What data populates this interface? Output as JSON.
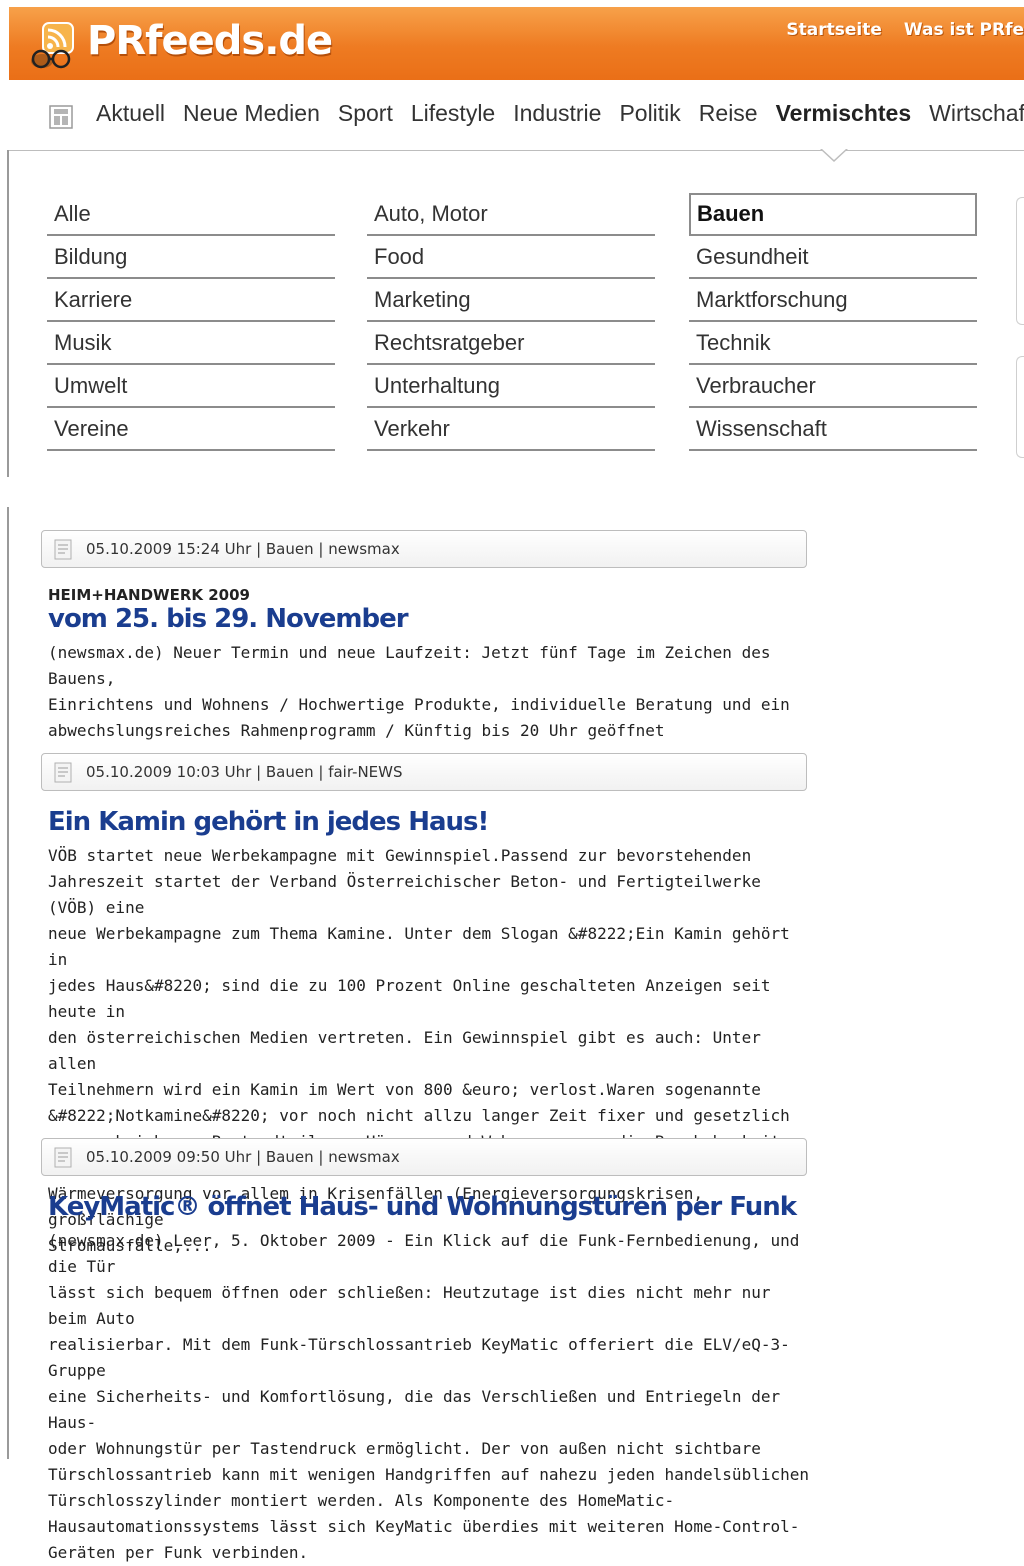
{
  "brand": {
    "logo_text": "PRfeeds.de",
    "accent": "#ef7d22",
    "link_color": "#1a3d8f"
  },
  "toplinks": [
    "Startseite",
    "Was ist PRfe"
  ],
  "nav": {
    "home_icon": "home-icon",
    "items": [
      "Aktuell",
      "Neue Medien",
      "Sport",
      "Lifestyle",
      "Industrie",
      "Politik",
      "Reise",
      "Vermischtes",
      "Wirtschaft"
    ],
    "active": "Vermischtes"
  },
  "categories": {
    "col1": [
      "Alle",
      "Bildung",
      "Karriere",
      "Musik",
      "Umwelt",
      "Vereine"
    ],
    "col2": [
      "Auto, Motor",
      "Food",
      "Marketing",
      "Rechtsratgeber",
      "Unterhaltung",
      "Verkehr"
    ],
    "col3": [
      "Bauen",
      "Gesundheit",
      "Marktforschung",
      "Technik",
      "Verbraucher",
      "Wissenschaft"
    ],
    "selected": "Bauen"
  },
  "articles": [
    {
      "meta": "05.10.2009 15:24 Uhr | Bauen | newsmax",
      "kicker": "HEIM+HANDWERK 2009",
      "title": "vom 25. bis 29. November",
      "lines": [
        "(newsmax.de) Neuer Termin und neue Laufzeit: Jetzt fünf Tage im Zeichen des Bauens,",
        "Einrichtens und Wohnens / Hochwertige Produkte, individuelle Beratung und ein",
        "abwechslungsreiches Rahmenprogramm / Künftig bis 20 Uhr geöffnet"
      ]
    },
    {
      "meta": "05.10.2009 10:03 Uhr | Bauen | fair-NEWS",
      "kicker": "",
      "title": "Ein Kamin gehört in jedes Haus!",
      "lines": [
        "VÖB startet neue Werbekampagne mit Gewinnspiel.Passend zur bevorstehenden",
        "Jahreszeit startet der Verband Österreichischer Beton- und Fertigteilwerke (VÖB) eine",
        "neue Werbekampagne zum Thema Kamine. Unter dem Slogan &#8222;Ein Kamin gehört in",
        "jedes Haus&#8220; sind die zu 100 Prozent Online geschalteten Anzeigen seit heute in",
        "den österreichischen Medien vertreten. Ein Gewinnspiel gibt es auch: Unter allen",
        "Teilnehmern wird ein Kamin im Wert von 800 &euro; verlost.Waren sogenannte",
        "&#8222;Notkamine&#8220; vor noch nicht allzu langer Zeit fixer und gesetzlich",
        "vorgeschriebener Bestandteil von Häusern und Wohnungen, um die Bewohnbarkeit und",
        "Wärmeversorgung vor allem in Krisenfällen (Energieversorgungskrisen, großflächige",
        "Stromausfälle,..."
      ]
    },
    {
      "meta": "05.10.2009 09:50 Uhr | Bauen | newsmax",
      "kicker": "",
      "title": "KeyMatic® öffnet Haus- und Wohnungstüren per Funk",
      "lines": [
        "(newsmax.de) Leer, 5. Oktober 2009 - Ein Klick auf die Funk-Fernbedienung, und die Tür",
        "lässt sich bequem öffnen oder schließen: Heutzutage ist dies nicht mehr nur beim Auto",
        "realisierbar. Mit dem Funk-Türschlossantrieb KeyMatic offeriert die ELV/eQ-3-Gruppe",
        "eine Sicherheits- und Komfortlösung, die das Verschließen und Entriegeln der Haus-",
        "oder Wohnungstür per Tastendruck ermöglicht. Der von außen nicht sichtbare",
        "Türschlossantrieb kann mit wenigen Handgriffen auf nahezu jeden handelsüblichen",
        "Türschlosszylinder montiert werden. Als Komponente des HomeMatic-",
        "Hausautomationssystems lässt sich KeyMatic überdies mit weiteren Home-Control-",
        "Geräten per Funk verbinden."
      ]
    }
  ]
}
